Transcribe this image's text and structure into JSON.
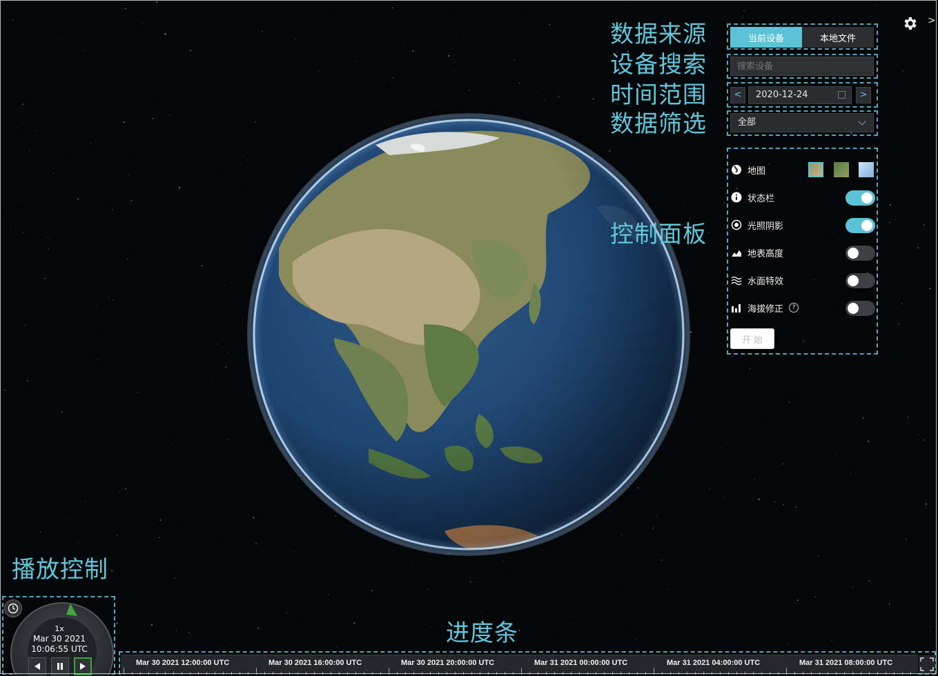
{
  "annotations": {
    "data_source": "数据来源",
    "device_search": "设备搜索",
    "time_range": "时间范围",
    "data_filter": "数据筛选",
    "control_panel": "控制面板",
    "playback_control": "播放控制",
    "progress_bar": "进度条"
  },
  "source_tabs": {
    "current_device": "当前设备",
    "local_file": "本地文件",
    "active": "当前设备"
  },
  "search": {
    "placeholder": "搜索设备"
  },
  "date_range": {
    "value": "2020-12-24",
    "prev": "<",
    "next": ">"
  },
  "filter": {
    "selected": "全部"
  },
  "controls": {
    "map": {
      "label": "地图"
    },
    "status_bar": {
      "label": "状态栏",
      "enabled": true
    },
    "lighting": {
      "label": "光照阴影",
      "enabled": true
    },
    "terrain": {
      "label": "地表高度",
      "enabled": false
    },
    "water": {
      "label": "水面特效",
      "enabled": false
    },
    "altitude_fix": {
      "label": "海拔修正",
      "enabled": false
    },
    "help_glyph": "?",
    "start_button": "开 始"
  },
  "animation": {
    "speed": "1x",
    "date": "Mar 30 2021",
    "time": "10:06:55 UTC"
  },
  "timeline": {
    "labels": [
      "Mar 30 2021 12:00:00 UTC",
      "Mar 30 2021 16:00:00 UTC",
      "Mar 30 2021 20:00:00 UTC",
      "Mar 31 2021 00:00:00 UTC",
      "Mar 31 2021 04:00:00 UTC",
      "Mar 31 2021 08:00:00 UTC"
    ]
  },
  "colors": {
    "accent": "#5cc3d6",
    "annotation": "#5ec7dc",
    "background": "#050608"
  },
  "icons": {
    "settings": "gear-icon",
    "collapse": "chevron-right-icon",
    "map": "globe-icon",
    "status_bar": "info-icon",
    "lighting": "sun-icon",
    "terrain": "terrain-icon",
    "water": "water-icon",
    "altitude": "chart-icon",
    "clock": "clock-icon",
    "fullscreen": "fullscreen-icon"
  }
}
